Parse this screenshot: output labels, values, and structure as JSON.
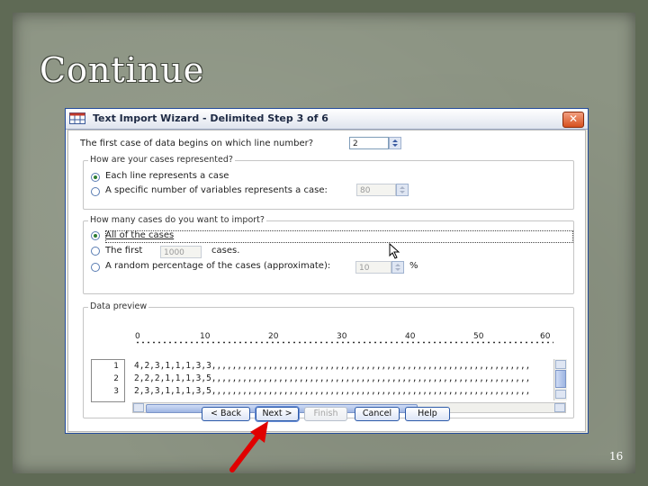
{
  "slide": {
    "title": "Continue",
    "page_number": "16"
  },
  "dialog": {
    "title": "Text Import Wizard - Delimited Step 3 of 6",
    "close_label": "✕",
    "first_case": {
      "label": "The first case of data begins on which line number?",
      "value": "2"
    },
    "representation": {
      "legend": "How are your cases represented?",
      "options": [
        {
          "label": "Each line represents a case",
          "checked": true
        },
        {
          "label": "A specific number of variables represents a case:",
          "checked": false
        }
      ],
      "variables_value": "80"
    },
    "import_count": {
      "legend": "How many cases do you want to import?",
      "options": [
        {
          "label": "All of the cases",
          "checked": true
        },
        {
          "label": "The first",
          "checked": false
        },
        {
          "label": "A random percentage of the cases (approximate):",
          "checked": false
        }
      ],
      "first_value": "1000",
      "first_suffix": "cases.",
      "percent_value": "10",
      "percent_suffix": "%"
    },
    "data_preview": {
      "legend": "Data preview",
      "ruler_labels": [
        "0",
        "10",
        "20",
        "30",
        "40",
        "50",
        "60"
      ],
      "rows": [
        {
          "num": "1",
          "text": "4,2,3,1,1,1,3,3,,,,,,,,,,,,,,,,,,,,,,,,,,,,,,,,,,,,,,,,,,,,,,,,,,,,,,,,,,,,,,"
        },
        {
          "num": "2",
          "text": "2,2,2,1,1,1,3,5,,,,,,,,,,,,,,,,,,,,,,,,,,,,,,,,,,,,,,,,,,,,,,,,,,,,,,,,,,,,,,"
        },
        {
          "num": "3",
          "text": "2,3,3,1,1,1,3,5,,,,,,,,,,,,,,,,,,,,,,,,,,,,,,,,,,,,,,,,,,,,,,,,,,,,,,,,,,,,,,"
        }
      ]
    },
    "buttons": {
      "back": "< Back",
      "next": "Next >",
      "finish": "Finish",
      "cancel": "Cancel",
      "help": "Help"
    }
  },
  "colors": {
    "annotation_arrow": "#e00000",
    "dialog_border": "#244c9c"
  }
}
